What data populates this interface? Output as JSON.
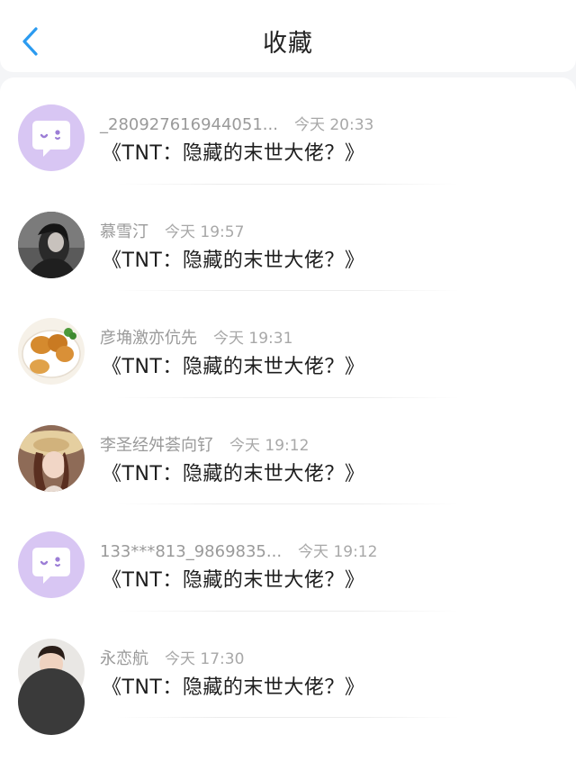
{
  "header": {
    "title": "收藏",
    "back_icon": "chevron-left-icon",
    "back_color": "#2b9bf0"
  },
  "items": [
    {
      "user": "_280927616944051...",
      "time": "今天 20:33",
      "content": "《TNT：隐藏的末世大佬？》",
      "avatar": "default-chat-avatar"
    },
    {
      "user": "慕雪汀",
      "time": "今天 19:57",
      "content": "《TNT：隐藏的末世大佬？》",
      "avatar": "photo-woman-dark"
    },
    {
      "user": "彦埆激亦伉先",
      "time": "今天 19:31",
      "content": "《TNT：隐藏的末世大佬？》",
      "avatar": "photo-food-plate"
    },
    {
      "user": "李圣经舛荟向钌",
      "time": "今天 19:12",
      "content": "《TNT：隐藏的末世大佬？》",
      "avatar": "photo-woman-hat"
    },
    {
      "user": "133***813_9869835...",
      "time": "今天 19:12",
      "content": "《TNT：隐藏的末世大佬？》",
      "avatar": "default-chat-avatar"
    },
    {
      "user": "永恋航",
      "time": "今天 17:30",
      "content": "《TNT：隐藏的末世大佬？》",
      "avatar": "photo-boy-jersey"
    }
  ],
  "colors": {
    "default_avatar_bg": "#d8c6f3",
    "meta_text": "#9a9a9a",
    "content_text": "#1e1e1e"
  }
}
